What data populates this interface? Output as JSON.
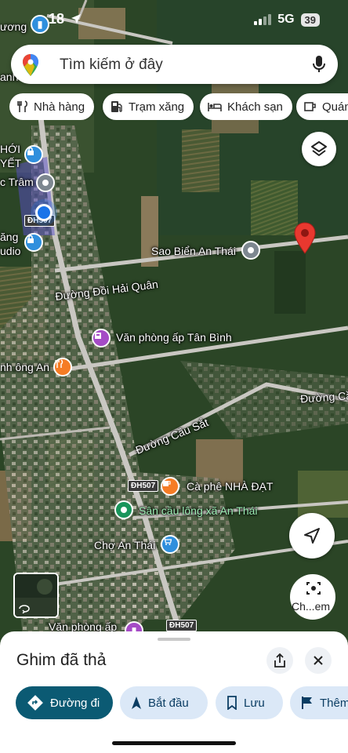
{
  "status": {
    "time": "18",
    "network": "5G",
    "battery": "39"
  },
  "search": {
    "placeholder": "Tìm kiếm ở đây"
  },
  "chips": [
    {
      "label": "Nhà hàng",
      "icon": "fork-knife-icon"
    },
    {
      "label": "Trạm xăng",
      "icon": "gas-pump-icon"
    },
    {
      "label": "Khách sạn",
      "icon": "bed-icon"
    },
    {
      "label": "Quán",
      "icon": "coffee-cup-icon"
    }
  ],
  "map": {
    "labels": {
      "duong_top": "ương",
      "anh_edge": "anh",
      "hoi_edge": "HỚI",
      "yet_edge": "YẾT",
      "tram_edge": "c Trâm",
      "dh507_a": "ĐH507",
      "ang_edge": "ăng",
      "audio_edge": "udio",
      "sao_bien": "Sao Biển An Thái",
      "doi_hai_quan": "Đường Đồi Hải Quân",
      "van_phong_tan_binh": "Văn phòng ấp Tân Bình",
      "ong_an": "nh ông An",
      "duong_cau_right": "Đường Cầu",
      "duong_cau_sat": "Đường Cầu Sắt",
      "dh507_b": "ĐH507",
      "ca_phe": "Cà phê NHÀ ĐẠT",
      "san_cau_long": "Sân cầu lông xã An Thái",
      "cho_an_thai": "Chợ An Thái",
      "dh507_c": "ĐH507",
      "van_phong_ap_bottom": "Văn phòng ấp"
    }
  },
  "controls": {
    "lens_label": "Ch...em"
  },
  "sheet": {
    "title": "Ghim đã thả",
    "actions": [
      {
        "label": "Đường đi",
        "icon": "directions-icon"
      },
      {
        "label": "Bắt đầu",
        "icon": "navigation-arrow-icon"
      },
      {
        "label": "Lưu",
        "icon": "bookmark-icon"
      },
      {
        "label": "Thêm",
        "icon": "flag-icon"
      }
    ]
  },
  "colors": {
    "brand_teal": "#0b5a73",
    "pin_red": "#e8382f",
    "poi_purple": "#a54bc6",
    "poi_orange": "#f57c25",
    "poi_blue": "#2f8fdd",
    "poi_green": "#19955b",
    "poi_gray": "#7d8790",
    "location_blue": "#1a73e8"
  }
}
